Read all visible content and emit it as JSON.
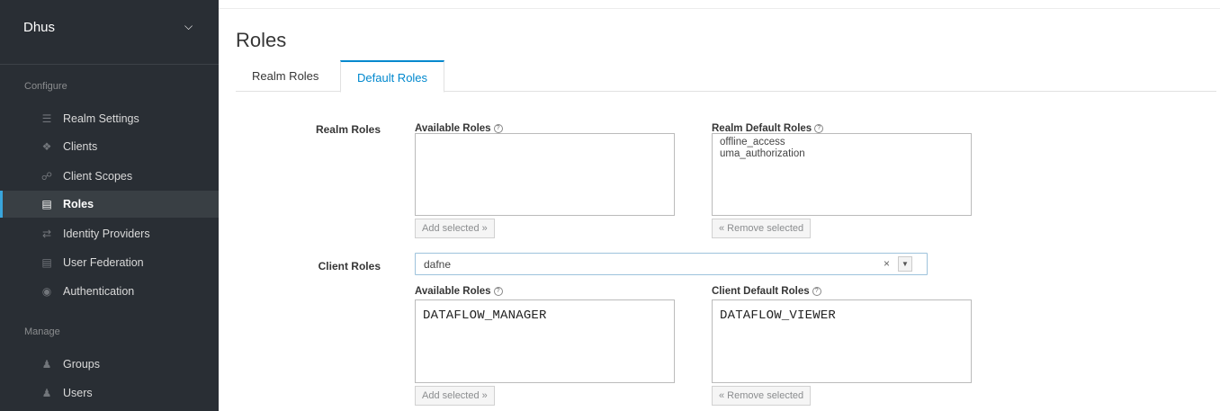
{
  "sidebar": {
    "realm": "Dhus",
    "configure_title": "Configure",
    "manage_title": "Manage",
    "configure_items": [
      {
        "label": "Realm Settings",
        "icon": "bars-icon"
      },
      {
        "label": "Clients",
        "icon": "cube-icon"
      },
      {
        "label": "Client Scopes",
        "icon": "share-icon"
      },
      {
        "label": "Roles",
        "icon": "list-icon"
      },
      {
        "label": "Identity Providers",
        "icon": "exchange-icon"
      },
      {
        "label": "User Federation",
        "icon": "database-icon"
      },
      {
        "label": "Authentication",
        "icon": "lock-icon"
      }
    ],
    "manage_items": [
      {
        "label": "Groups",
        "icon": "users-icon"
      },
      {
        "label": "Users",
        "icon": "user-icon"
      }
    ],
    "active_item": "Roles"
  },
  "main": {
    "title": "Roles",
    "tabs": [
      {
        "label": "Realm Roles"
      },
      {
        "label": "Default Roles"
      }
    ],
    "active_tab": "Default Roles",
    "realm_roles": {
      "label": "Realm Roles",
      "available_label": "Available Roles",
      "default_label": "Realm Default Roles",
      "available": [],
      "defaults": [
        "offline_access",
        "uma_authorization"
      ],
      "add_button": "Add selected »",
      "remove_button": "« Remove selected"
    },
    "client_roles": {
      "label": "Client Roles",
      "client_value": "dafne",
      "clear_symbol": "×",
      "arrow_symbol": "▼",
      "available_label": "Available Roles",
      "default_label": "Client Default Roles",
      "available": [
        "DATAFLOW_MANAGER"
      ],
      "defaults": [
        "DATAFLOW_VIEWER"
      ],
      "add_button": "Add selected »",
      "remove_button": "« Remove selected"
    }
  },
  "colors": {
    "sidebar_bg": "#292e34",
    "accent": "#0088ce",
    "active_bar": "#39a5dc"
  }
}
